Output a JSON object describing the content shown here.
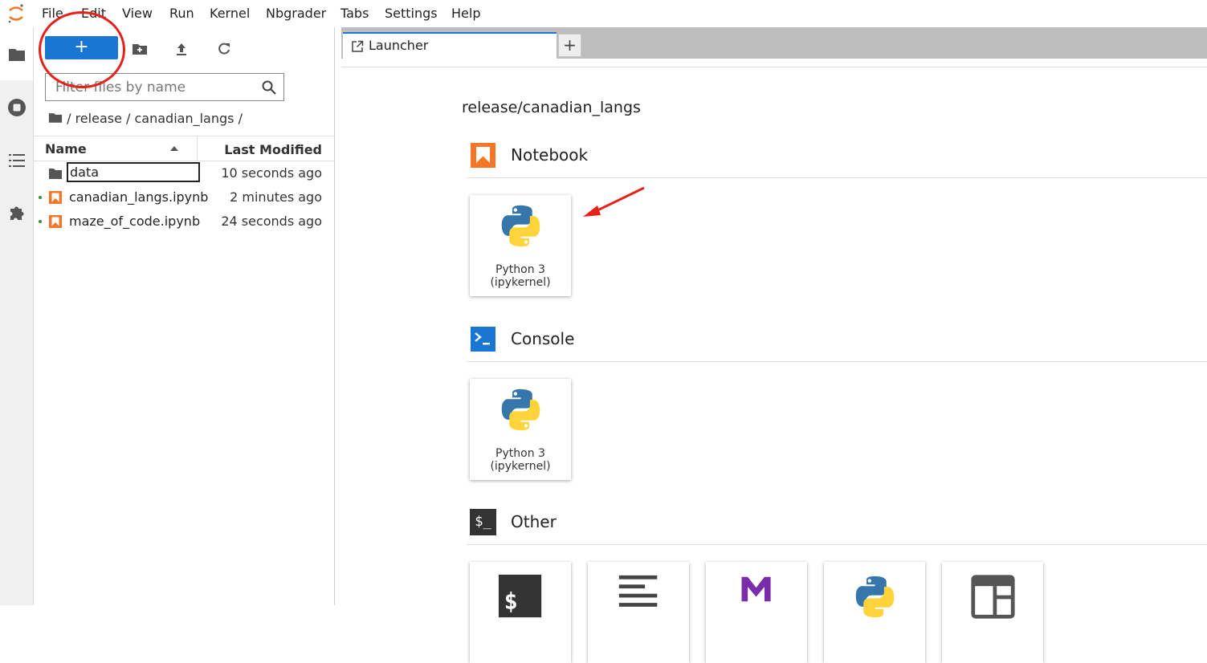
{
  "menu": [
    "File",
    "Edit",
    "View",
    "Run",
    "Kernel",
    "Nbgrader",
    "Tabs",
    "Settings",
    "Help"
  ],
  "activity_bar": [
    "folder-icon",
    "running-stop-icon",
    "toc-list-icon",
    "extension-puzzle-icon"
  ],
  "file_browser": {
    "new_label": "+",
    "filter_placeholder": "Filter files by name",
    "breadcrumb": [
      "release",
      "canadian_langs"
    ],
    "breadcrumb_separator": "/",
    "columns": {
      "name": "Name",
      "modified": "Last Modified"
    },
    "files": [
      {
        "name": "data",
        "type": "folder",
        "modified": "10 seconds ago",
        "running": false,
        "editing": true
      },
      {
        "name": "canadian_langs.ipynb",
        "type": "notebook",
        "modified": "2 minutes ago",
        "running": true
      },
      {
        "name": "maze_of_code.ipynb",
        "type": "notebook",
        "modified": "24 seconds ago",
        "running": true
      }
    ]
  },
  "tabs": [
    {
      "label": "Launcher",
      "active": true
    }
  ],
  "launcher": {
    "cwd": "release/canadian_langs",
    "sections": {
      "notebook": {
        "title": "Notebook",
        "cards": [
          {
            "line1": "Python 3",
            "line2": "(ipykernel)"
          }
        ]
      },
      "console": {
        "title": "Console",
        "cards": [
          {
            "line1": "Python 3",
            "line2": "(ipykernel)"
          }
        ]
      },
      "other": {
        "title": "Other",
        "icon_text": "$_",
        "cards": [
          "terminal-icon",
          "text-file-icon",
          "markdown-icon",
          "python-file-icon",
          "show-contextual-help-icon"
        ]
      }
    }
  },
  "colors": {
    "accent": "#1976d2",
    "notebook_orange": "#f37726",
    "annotation_red": "#e8201a",
    "markdown_purple": "#7b2ca8"
  }
}
